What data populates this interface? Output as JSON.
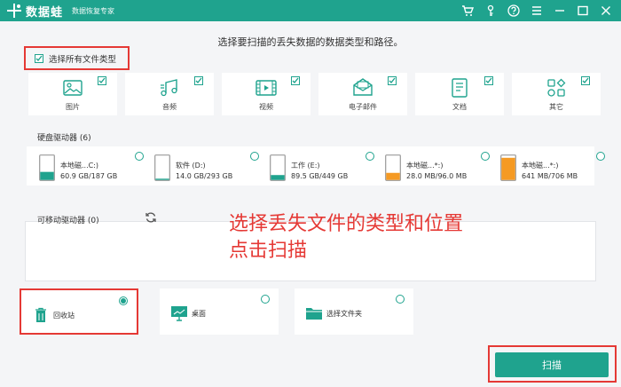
{
  "app": {
    "name": "数据蛙",
    "subtitle": "数据恢复专家"
  },
  "headline": "选择要扫描的丢失数据的数据类型和路径。",
  "select_all": {
    "label": "选择所有文件类型",
    "checked": true
  },
  "file_types": [
    {
      "label": "图片",
      "icon": "image-icon",
      "checked": true
    },
    {
      "label": "音频",
      "icon": "music-icon",
      "checked": true
    },
    {
      "label": "视频",
      "icon": "video-icon",
      "checked": true
    },
    {
      "label": "电子邮件",
      "icon": "email-icon",
      "checked": true
    },
    {
      "label": "文档",
      "icon": "document-icon",
      "checked": true
    },
    {
      "label": "其它",
      "icon": "other-icon",
      "checked": true
    }
  ],
  "disk_section": {
    "title": "硬盘驱动器 (6)",
    "disks": [
      {
        "name": "本地磁...C:)",
        "size": "60.9 GB/187 GB",
        "used_fraction": 0.33,
        "color": "#1fa38e"
      },
      {
        "name": "软件 (D:)",
        "size": "14.0 GB/293 GB",
        "used_fraction": 0.05,
        "color": "#1fa38e"
      },
      {
        "name": "工作 (E:)",
        "size": "89.5 GB/449 GB",
        "used_fraction": 0.2,
        "color": "#1fa38e"
      },
      {
        "name": "本地磁...*:)",
        "size": "28.0 MB/96.0 MB",
        "used_fraction": 0.29,
        "color": "#f59a23"
      },
      {
        "name": "本地磁...*:)",
        "size": "641 MB/706 MB",
        "used_fraction": 0.91,
        "color": "#f59a23"
      }
    ]
  },
  "removable_section": {
    "title": "可移动驱动器 (0)"
  },
  "overlay_text": {
    "line1": "选择丢失文件的类型和位置",
    "line2": "点击扫描"
  },
  "locations": [
    {
      "label": "回收站",
      "icon": "trash-icon",
      "selected": true
    },
    {
      "label": "桌面",
      "icon": "desktop-icon",
      "selected": false
    },
    {
      "label": "选择文件夹",
      "icon": "folder-icon",
      "selected": false
    }
  ],
  "scan_button": {
    "label": "扫描"
  },
  "colors": {
    "accent": "#1fa38e",
    "highlight": "#e53935",
    "warning": "#f59a23"
  }
}
